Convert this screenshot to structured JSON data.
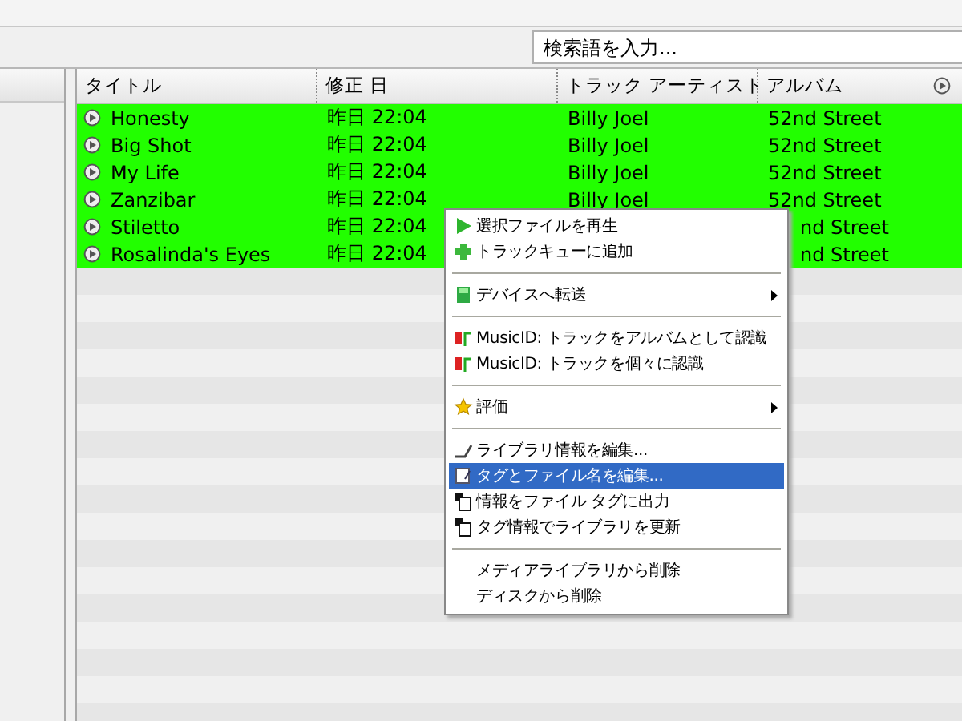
{
  "search": {
    "placeholder": "検索語を入力..."
  },
  "table": {
    "columns": [
      "タイトル",
      "修正 日",
      "トラック アーティスト",
      "アルバム"
    ],
    "rows": [
      {
        "title": "Honesty",
        "modified": "昨日 22:04",
        "artist": "Billy Joel",
        "album": "52nd Street",
        "selected": true
      },
      {
        "title": "Big Shot",
        "modified": "昨日 22:04",
        "artist": "Billy Joel",
        "album": "52nd Street",
        "selected": true
      },
      {
        "title": "My Life",
        "modified": "昨日 22:04",
        "artist": "Billy Joel",
        "album": "52nd Street",
        "selected": true
      },
      {
        "title": "Zanzibar",
        "modified": "昨日 22:04",
        "artist": "Billy Joel",
        "album": "52nd Street",
        "selected": true
      },
      {
        "title": "Stiletto",
        "modified": "昨日 22:04",
        "album": "nd Street",
        "selected": true
      },
      {
        "title": "Rosalinda's Eyes",
        "modified": "昨日 22:04",
        "album": "nd Street",
        "selected": true
      }
    ]
  },
  "context_menu": {
    "items": [
      {
        "kind": "item",
        "label": "選択ファイルを再生",
        "submenu": false,
        "selected": false
      },
      {
        "kind": "item",
        "label": "トラックキューに追加",
        "submenu": false,
        "selected": false
      },
      {
        "kind": "separator"
      },
      {
        "kind": "item",
        "label": "デバイスへ転送",
        "submenu": true,
        "selected": false
      },
      {
        "kind": "separator"
      },
      {
        "kind": "item",
        "label": "MusicID: トラックをアルバムとして認識",
        "submenu": false,
        "selected": false
      },
      {
        "kind": "item",
        "label": "MusicID: トラックを個々に認識",
        "submenu": false,
        "selected": false
      },
      {
        "kind": "separator"
      },
      {
        "kind": "item",
        "label": "評価",
        "submenu": true,
        "selected": false
      },
      {
        "kind": "separator"
      },
      {
        "kind": "item",
        "label": "ライブラリ情報を編集...",
        "submenu": false,
        "selected": false
      },
      {
        "kind": "item",
        "label": "タグとファイル名を編集...",
        "submenu": false,
        "selected": true
      },
      {
        "kind": "item",
        "label": "情報をファイル タグに出力",
        "submenu": false,
        "selected": false
      },
      {
        "kind": "item",
        "label": "タグ情報でライブラリを更新",
        "submenu": false,
        "selected": false
      },
      {
        "kind": "separator"
      },
      {
        "kind": "item",
        "label": "メディアライブラリから削除",
        "submenu": false,
        "selected": false
      },
      {
        "kind": "item",
        "label": "ディスクから削除",
        "submenu": false,
        "selected": false
      }
    ]
  }
}
